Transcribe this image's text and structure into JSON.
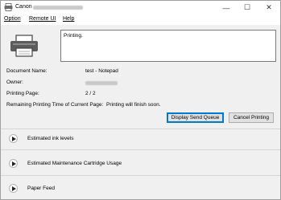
{
  "window": {
    "title": "Canon",
    "controls": {
      "minimize": "—",
      "maximize": "☐",
      "close": "✕"
    }
  },
  "menu": {
    "items": [
      {
        "label": "Option"
      },
      {
        "label": "Remote UI"
      },
      {
        "label": "Help"
      }
    ]
  },
  "status": {
    "message": "Printing."
  },
  "info": {
    "document_name_label": "Document Name:",
    "document_name_value": "test - Notepad",
    "owner_label": "Owner:",
    "printing_page_label": "Printing Page:",
    "printing_page_value": "2 / 2",
    "remaining_label": "Remaining Printing Time of Current Page:",
    "remaining_value": "Printing will finish soon."
  },
  "buttons": {
    "display_send_queue": "Display Send Queue",
    "cancel_printing": "Cancel Printing"
  },
  "sections": [
    {
      "label": "Estimated ink levels"
    },
    {
      "label": "Estimated Maintenance Cartridge Usage"
    },
    {
      "label": "Paper Feed"
    }
  ],
  "icons": {
    "app": "canon-printer-app-icon",
    "printer": "printer-icon",
    "expand": "expand-arrow-icon"
  }
}
